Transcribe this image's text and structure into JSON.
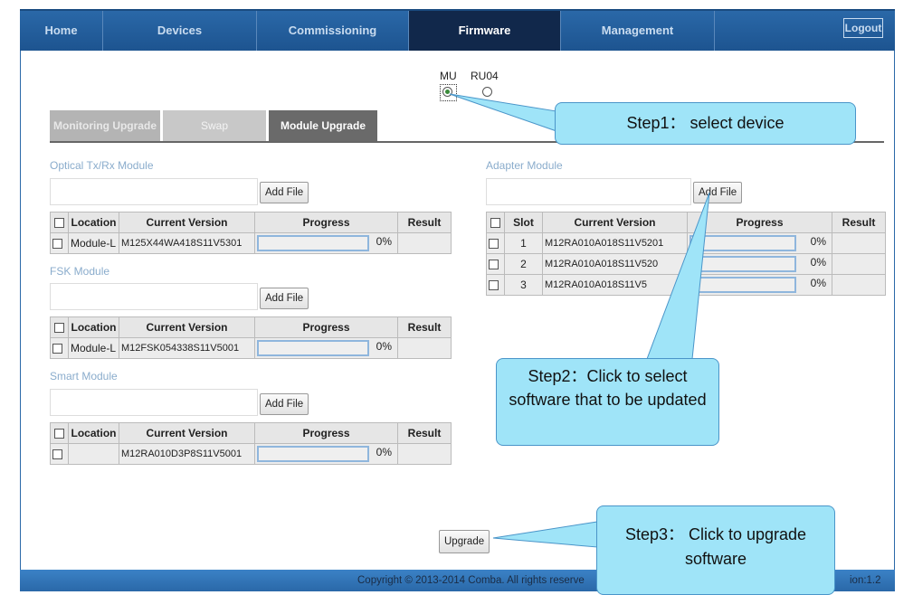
{
  "nav": {
    "items": [
      "Home",
      "Devices",
      "Commissioning",
      "Firmware",
      "Management"
    ],
    "active": "Firmware",
    "logout_label": "Logout"
  },
  "devices": {
    "options": [
      "MU",
      "RU04"
    ],
    "selected": "MU"
  },
  "subtabs": [
    "Monitoring Upgrade",
    "Swap",
    "Module Upgrade"
  ],
  "active_subtab": "Module Upgrade",
  "add_file_label": "Add File",
  "module_columns": [
    "Location",
    "Current Version",
    "Progress",
    "Result"
  ],
  "adapter_columns": [
    "Slot",
    "Current Version",
    "Progress",
    "Result"
  ],
  "optical": {
    "title": "Optical Tx/Rx Module",
    "rows": [
      {
        "location": "Module-L",
        "version": "M125X44WA418S11V5301",
        "progress": "0%",
        "result": ""
      }
    ]
  },
  "fsk": {
    "title": "FSK Module",
    "rows": [
      {
        "location": "Module-L",
        "version": "M12FSK054338S11V5001",
        "progress": "0%",
        "result": ""
      }
    ]
  },
  "smart": {
    "title": "Smart Module",
    "rows": [
      {
        "location": "",
        "version": "M12RA010D3P8S11V5001",
        "progress": "0%",
        "result": ""
      }
    ]
  },
  "adapter": {
    "title": "Adapter Module",
    "rows": [
      {
        "slot": "1",
        "version": "M12RA010A018S11V5201",
        "progress": "0%",
        "result": ""
      },
      {
        "slot": "2",
        "version": "M12RA010A018S11V520",
        "progress": "0%",
        "result": ""
      },
      {
        "slot": "3",
        "version": "M12RA010A018S11V5",
        "progress": "0%",
        "result": ""
      }
    ]
  },
  "upgrade_label": "Upgrade",
  "footer": {
    "copyright": "Copyright © 2013-2014 Comba. All rights reserve",
    "version": "ion:1.2"
  },
  "callouts": {
    "step1": "Step1： select device",
    "step2": "Step2：Click to select software that to be updated",
    "step3": "Step3： Click to upgrade software"
  },
  "colors": {
    "nav_bg": "#1d5490",
    "nav_active": "#11284b",
    "callout_fill": "#9fe4f8",
    "progress_border": "#8fb6dd"
  }
}
